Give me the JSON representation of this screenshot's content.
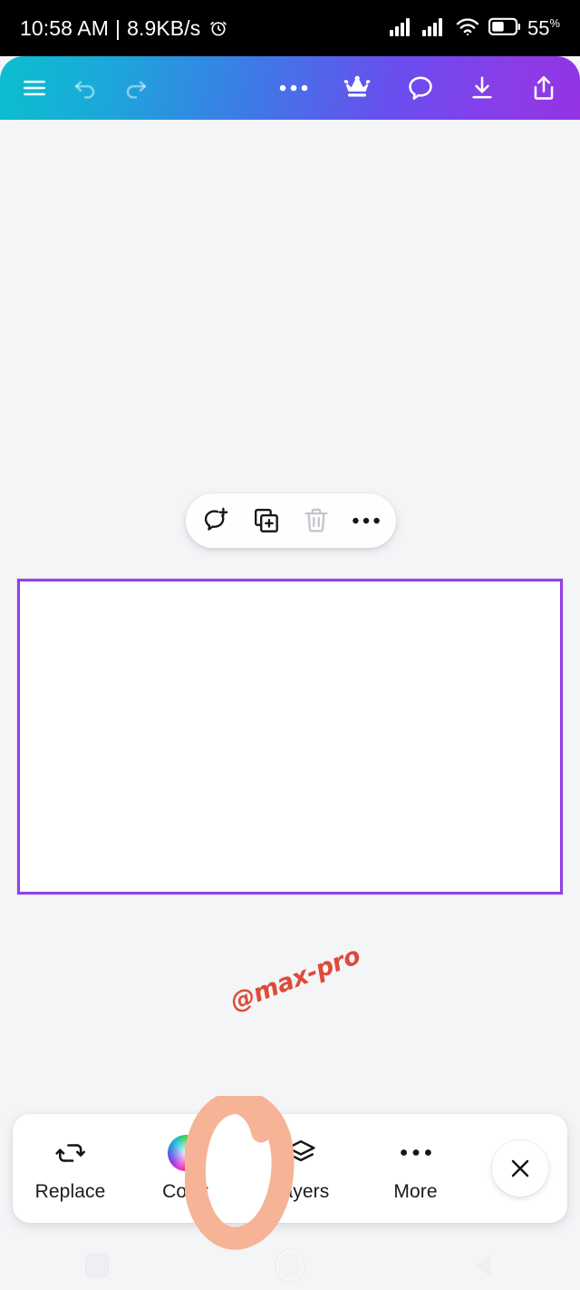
{
  "status_bar": {
    "time": "10:58 AM",
    "separator": "|",
    "network_speed": "8.9KB/s",
    "alarm_icon": "alarm-icon",
    "signal_1_icon": "signal-bars-icon",
    "signal_2_icon": "signal-bars-icon",
    "wifi_icon": "wifi-icon",
    "battery_icon": "battery-icon",
    "battery_percent": "55",
    "battery_unit": "%"
  },
  "top_bar": {
    "gradient_start": "#0BBFCE",
    "gradient_end": "#9233E4",
    "items": [
      {
        "name": "menu-icon",
        "label": "Menu"
      },
      {
        "name": "undo-icon",
        "label": "Undo"
      },
      {
        "name": "redo-icon",
        "label": "Redo"
      },
      {
        "name": "more-options-icon",
        "label": "More options"
      },
      {
        "name": "crown-icon",
        "label": "Pro"
      },
      {
        "name": "comment-icon",
        "label": "Comments"
      },
      {
        "name": "download-icon",
        "label": "Download"
      },
      {
        "name": "share-icon",
        "label": "Share"
      }
    ]
  },
  "element_toolbar": {
    "items": [
      {
        "name": "add-comment-icon",
        "label": "Add comment",
        "disabled": false
      },
      {
        "name": "duplicate-icon",
        "label": "Duplicate",
        "disabled": false
      },
      {
        "name": "delete-icon",
        "label": "Delete",
        "disabled": true
      },
      {
        "name": "more-icon",
        "label": "More",
        "disabled": false
      }
    ]
  },
  "canvas": {
    "background_color": "#F4F5F7",
    "selected_element": {
      "name": "selected-rectangle",
      "fill_color": "#FFFFFF",
      "selection_border_color": "#9141E8"
    },
    "watermark": {
      "text": "@max-pro",
      "color": "#DD4B3A",
      "rotation_degrees": -21
    }
  },
  "bottom_bar": {
    "items": [
      {
        "label": "Replace",
        "icon": "replace-icon"
      },
      {
        "label": "Color",
        "icon": "color-wheel-icon"
      },
      {
        "label": "Layers",
        "icon": "layers-icon"
      },
      {
        "label": "More",
        "icon": "more-dots-icon"
      }
    ],
    "close_label": "Close",
    "close_icon": "close-x-icon"
  },
  "annotation": {
    "name": "highlight-circle-annotation",
    "color": "#F6B396",
    "targets": "Color"
  },
  "nav_bar": {
    "recents_label": "Recents",
    "home_label": "Home",
    "back_label": "Back"
  }
}
